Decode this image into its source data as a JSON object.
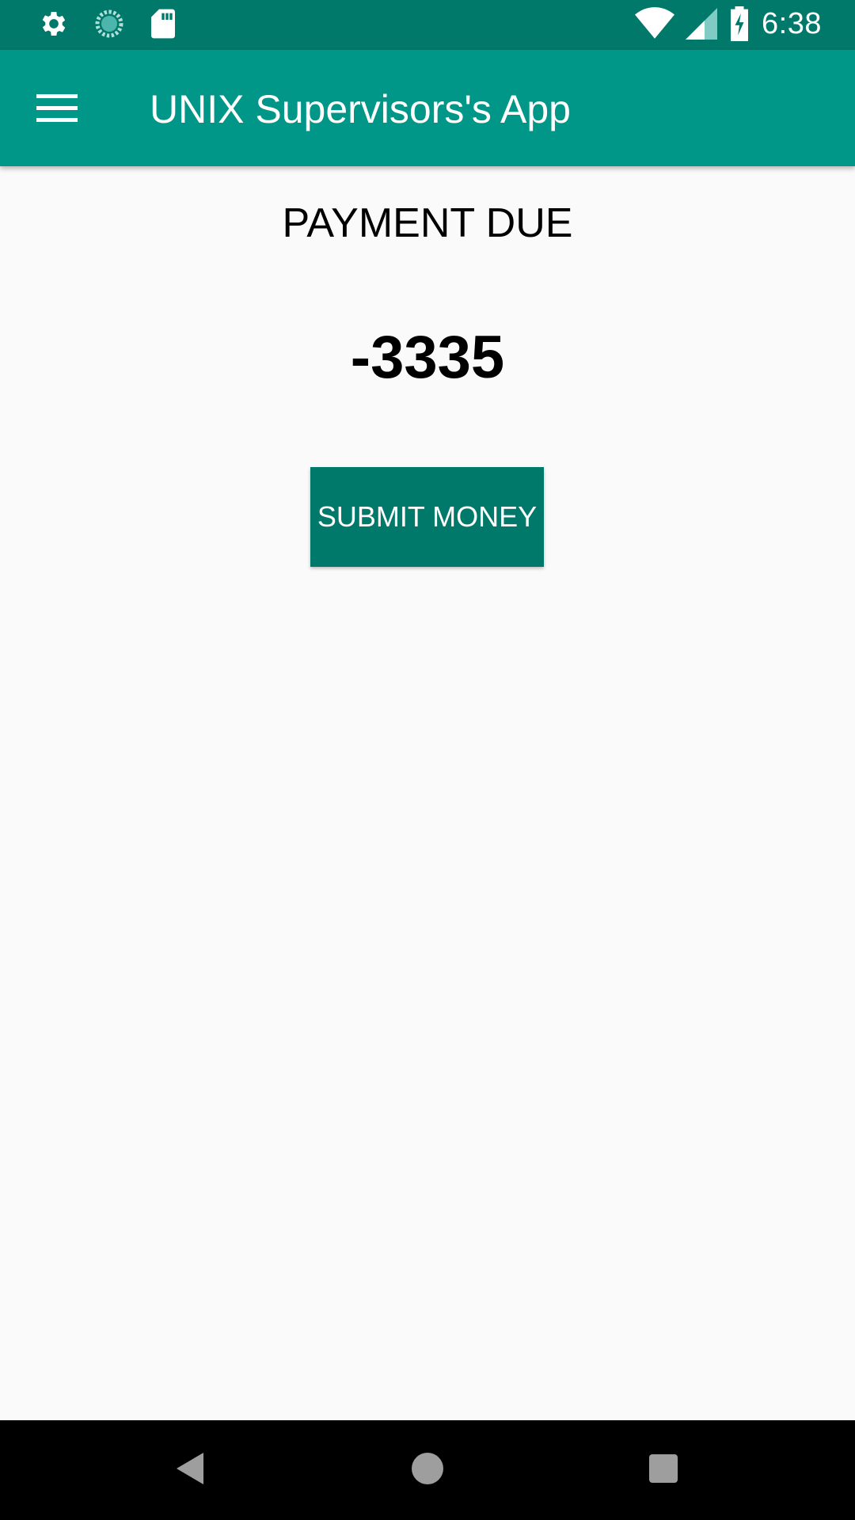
{
  "status_bar": {
    "time": "6:38",
    "icons_left": [
      "settings-icon",
      "sync-icon",
      "sd-card-icon"
    ],
    "icons_right": [
      "wifi-icon",
      "cell-signal-icon",
      "battery-charging-icon"
    ]
  },
  "app_bar": {
    "title": "UNIX Supervisors's App",
    "menu_icon": "hamburger-menu-icon"
  },
  "main": {
    "label": "PAYMENT DUE",
    "amount": "-3335",
    "submit_label": "SUBMIT MONEY"
  },
  "nav_bar": {
    "icons": [
      "back-icon",
      "home-icon",
      "recents-icon"
    ]
  },
  "colors": {
    "status_bar": "#00796b",
    "app_bar": "#009688",
    "button": "#00796b",
    "background": "#fafafa"
  }
}
